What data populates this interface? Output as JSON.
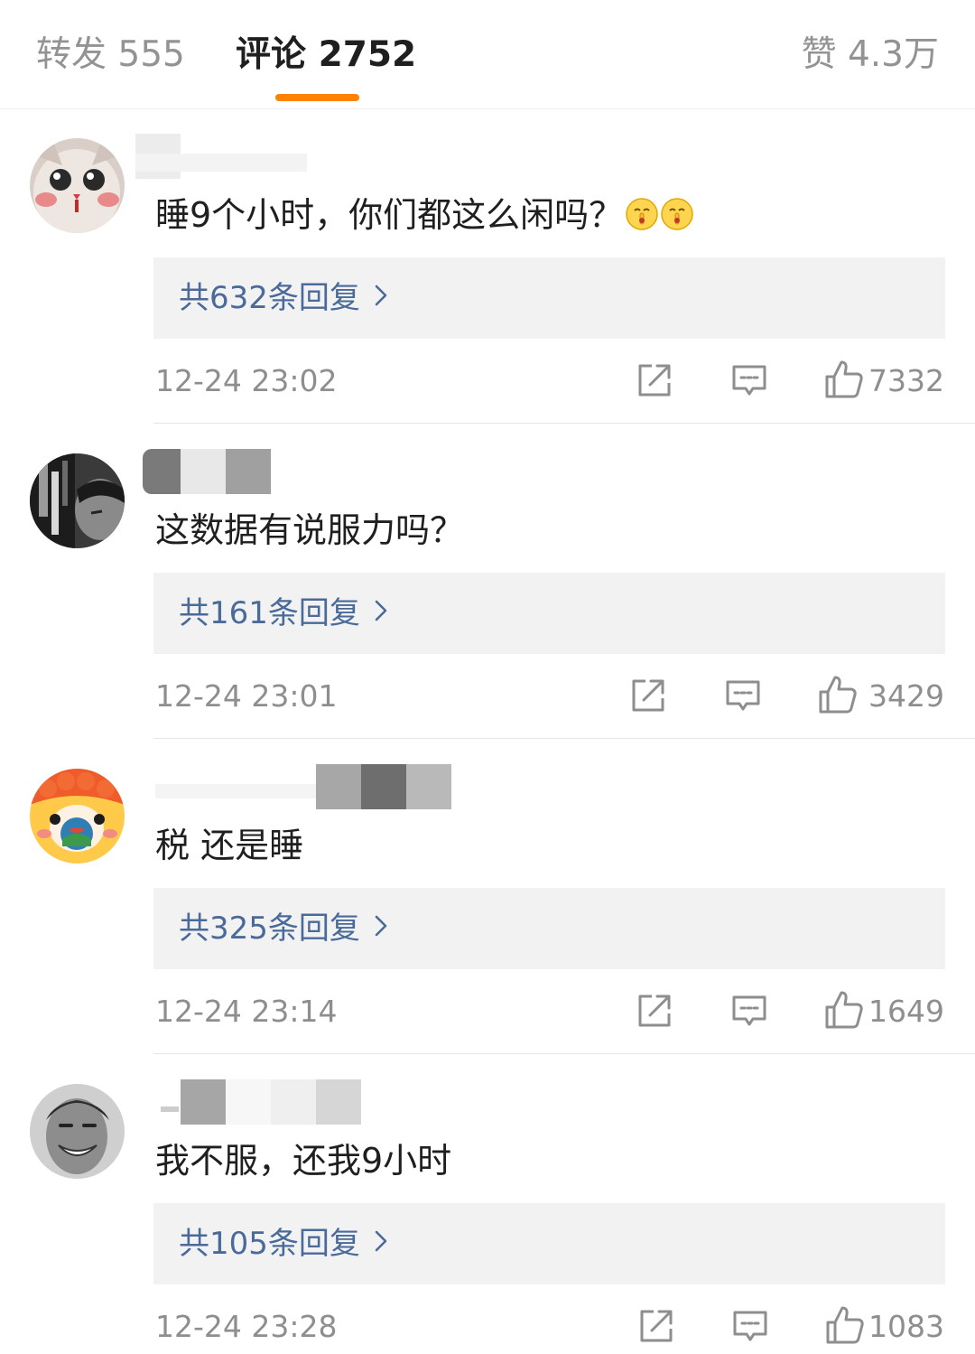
{
  "tabs": {
    "reposts": "转发 555",
    "comments": "评论 2752",
    "likes": "赞 4.3万"
  },
  "colors": {
    "accent": "#ff8200",
    "reply_link": "#4a6a99",
    "muted": "#8e8e8e"
  },
  "comments": [
    {
      "text": "睡9个小时，你们都这么闲吗？",
      "emojis": [
        "shush-emoji",
        "shush-emoji"
      ],
      "replies": "共632条回复",
      "time": "12-24 23:02",
      "likes": "7332"
    },
    {
      "text": "这数据有说服力吗？",
      "replies": "共161条回复",
      "time": "12-24 23:01",
      "likes": "3429"
    },
    {
      "text": "税 还是睡",
      "replies": "共325条回复",
      "time": "12-24 23:14",
      "likes": "1649"
    },
    {
      "text": "我不服，还我9小时",
      "replies": "共105条回复",
      "time": "12-24 23:28",
      "likes": "1083"
    }
  ]
}
